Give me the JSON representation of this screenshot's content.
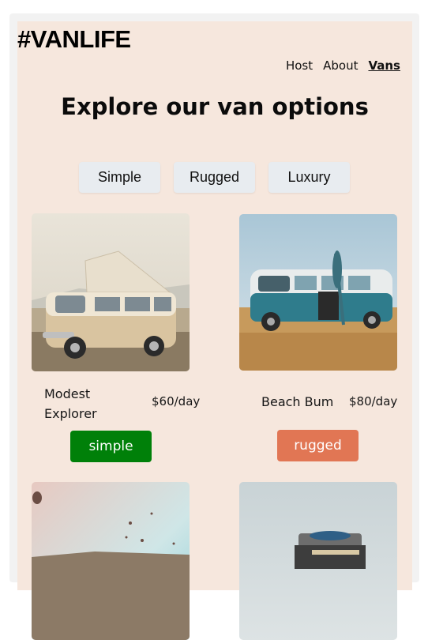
{
  "header": {
    "logo": "#VANLIFE",
    "nav": [
      {
        "label": "Host"
      },
      {
        "label": "About"
      },
      {
        "label": "Vans",
        "active": true
      }
    ]
  },
  "main": {
    "title": "Explore our van options",
    "filters": [
      "Simple",
      "Rugged",
      "Luxury"
    ],
    "vans": [
      {
        "name": "Modest Explorer",
        "price": "$60/day",
        "type": "simple"
      },
      {
        "name": "Beach Bum",
        "price": "$80/day",
        "type": "rugged"
      },
      {
        "name": "",
        "price": "",
        "type": ""
      },
      {
        "name": "",
        "price": "",
        "type": ""
      }
    ]
  },
  "colors": {
    "page_bg": "#f6e7dd",
    "simple": "#008009",
    "rugged": "#e17654",
    "filter_bg": "#e8ecf0"
  }
}
